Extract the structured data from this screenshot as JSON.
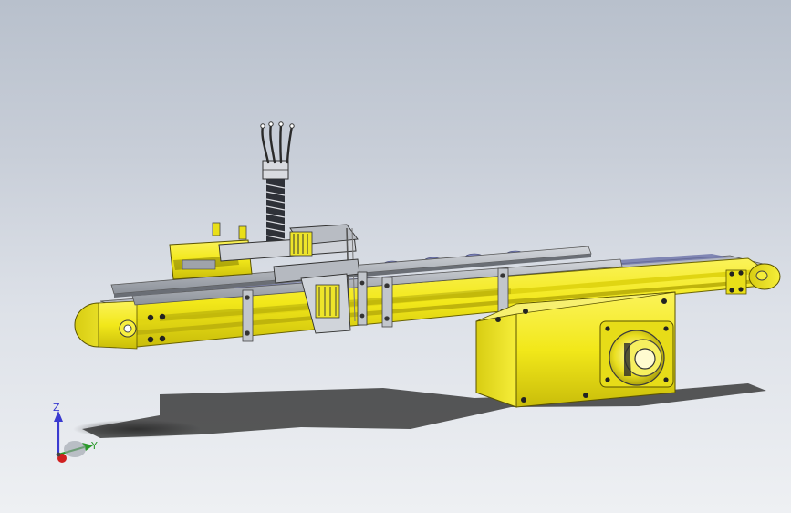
{
  "triad": {
    "z_label": "Z",
    "y_label": "Y",
    "z_color": "#3a3ad0",
    "y_color": "#2a9a2a",
    "x_color": "#d02020"
  },
  "colors": {
    "frame_yellow": "#f2e81a",
    "steel": "#a8adb4",
    "dark_steel": "#4a4e56",
    "belt_blue": "#6a70a8"
  }
}
